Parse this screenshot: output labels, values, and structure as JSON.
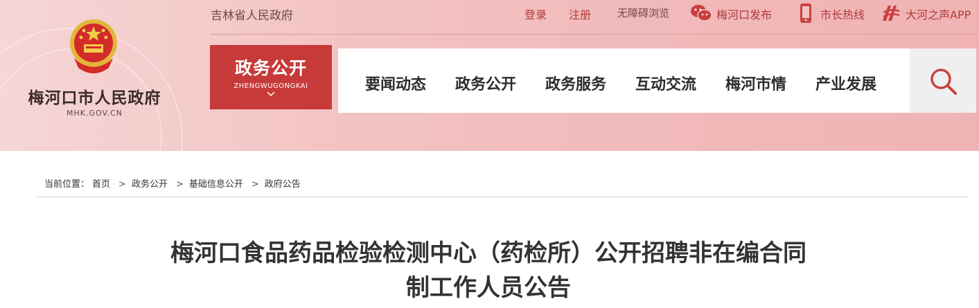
{
  "brand": {
    "site_name": "梅河口市人民政府",
    "domain": "MHK.GOV.CN",
    "emblem_icon": "national-emblem-icon"
  },
  "top": {
    "province_link": "吉林省人民政府",
    "login": "登录",
    "register": "注册",
    "accessibility": "无障碍浏览",
    "wechat": "梅河口发布",
    "hotline": "市长热线",
    "app": "大河之声APP"
  },
  "nav": {
    "active_label": "政务公开",
    "active_sub": "ZHENGWUGONGKAI",
    "items": [
      "要闻动态",
      "政务公开",
      "政务服务",
      "互动交流",
      "梅河市情",
      "产业发展"
    ],
    "search_icon": "search-icon"
  },
  "breadcrumb": {
    "prefix": "当前位置：",
    "items": [
      "首页",
      "政务公开",
      "基础信息公开",
      "政府公告"
    ],
    "separator": ">"
  },
  "article": {
    "title_line1": "梅河口食品药品检验检测中心（药检所）公开招聘非在编合同",
    "title_line2": "制工作人员公告"
  },
  "colors": {
    "accent": "#c73a3a",
    "header_bg": "#f3c3c3"
  }
}
